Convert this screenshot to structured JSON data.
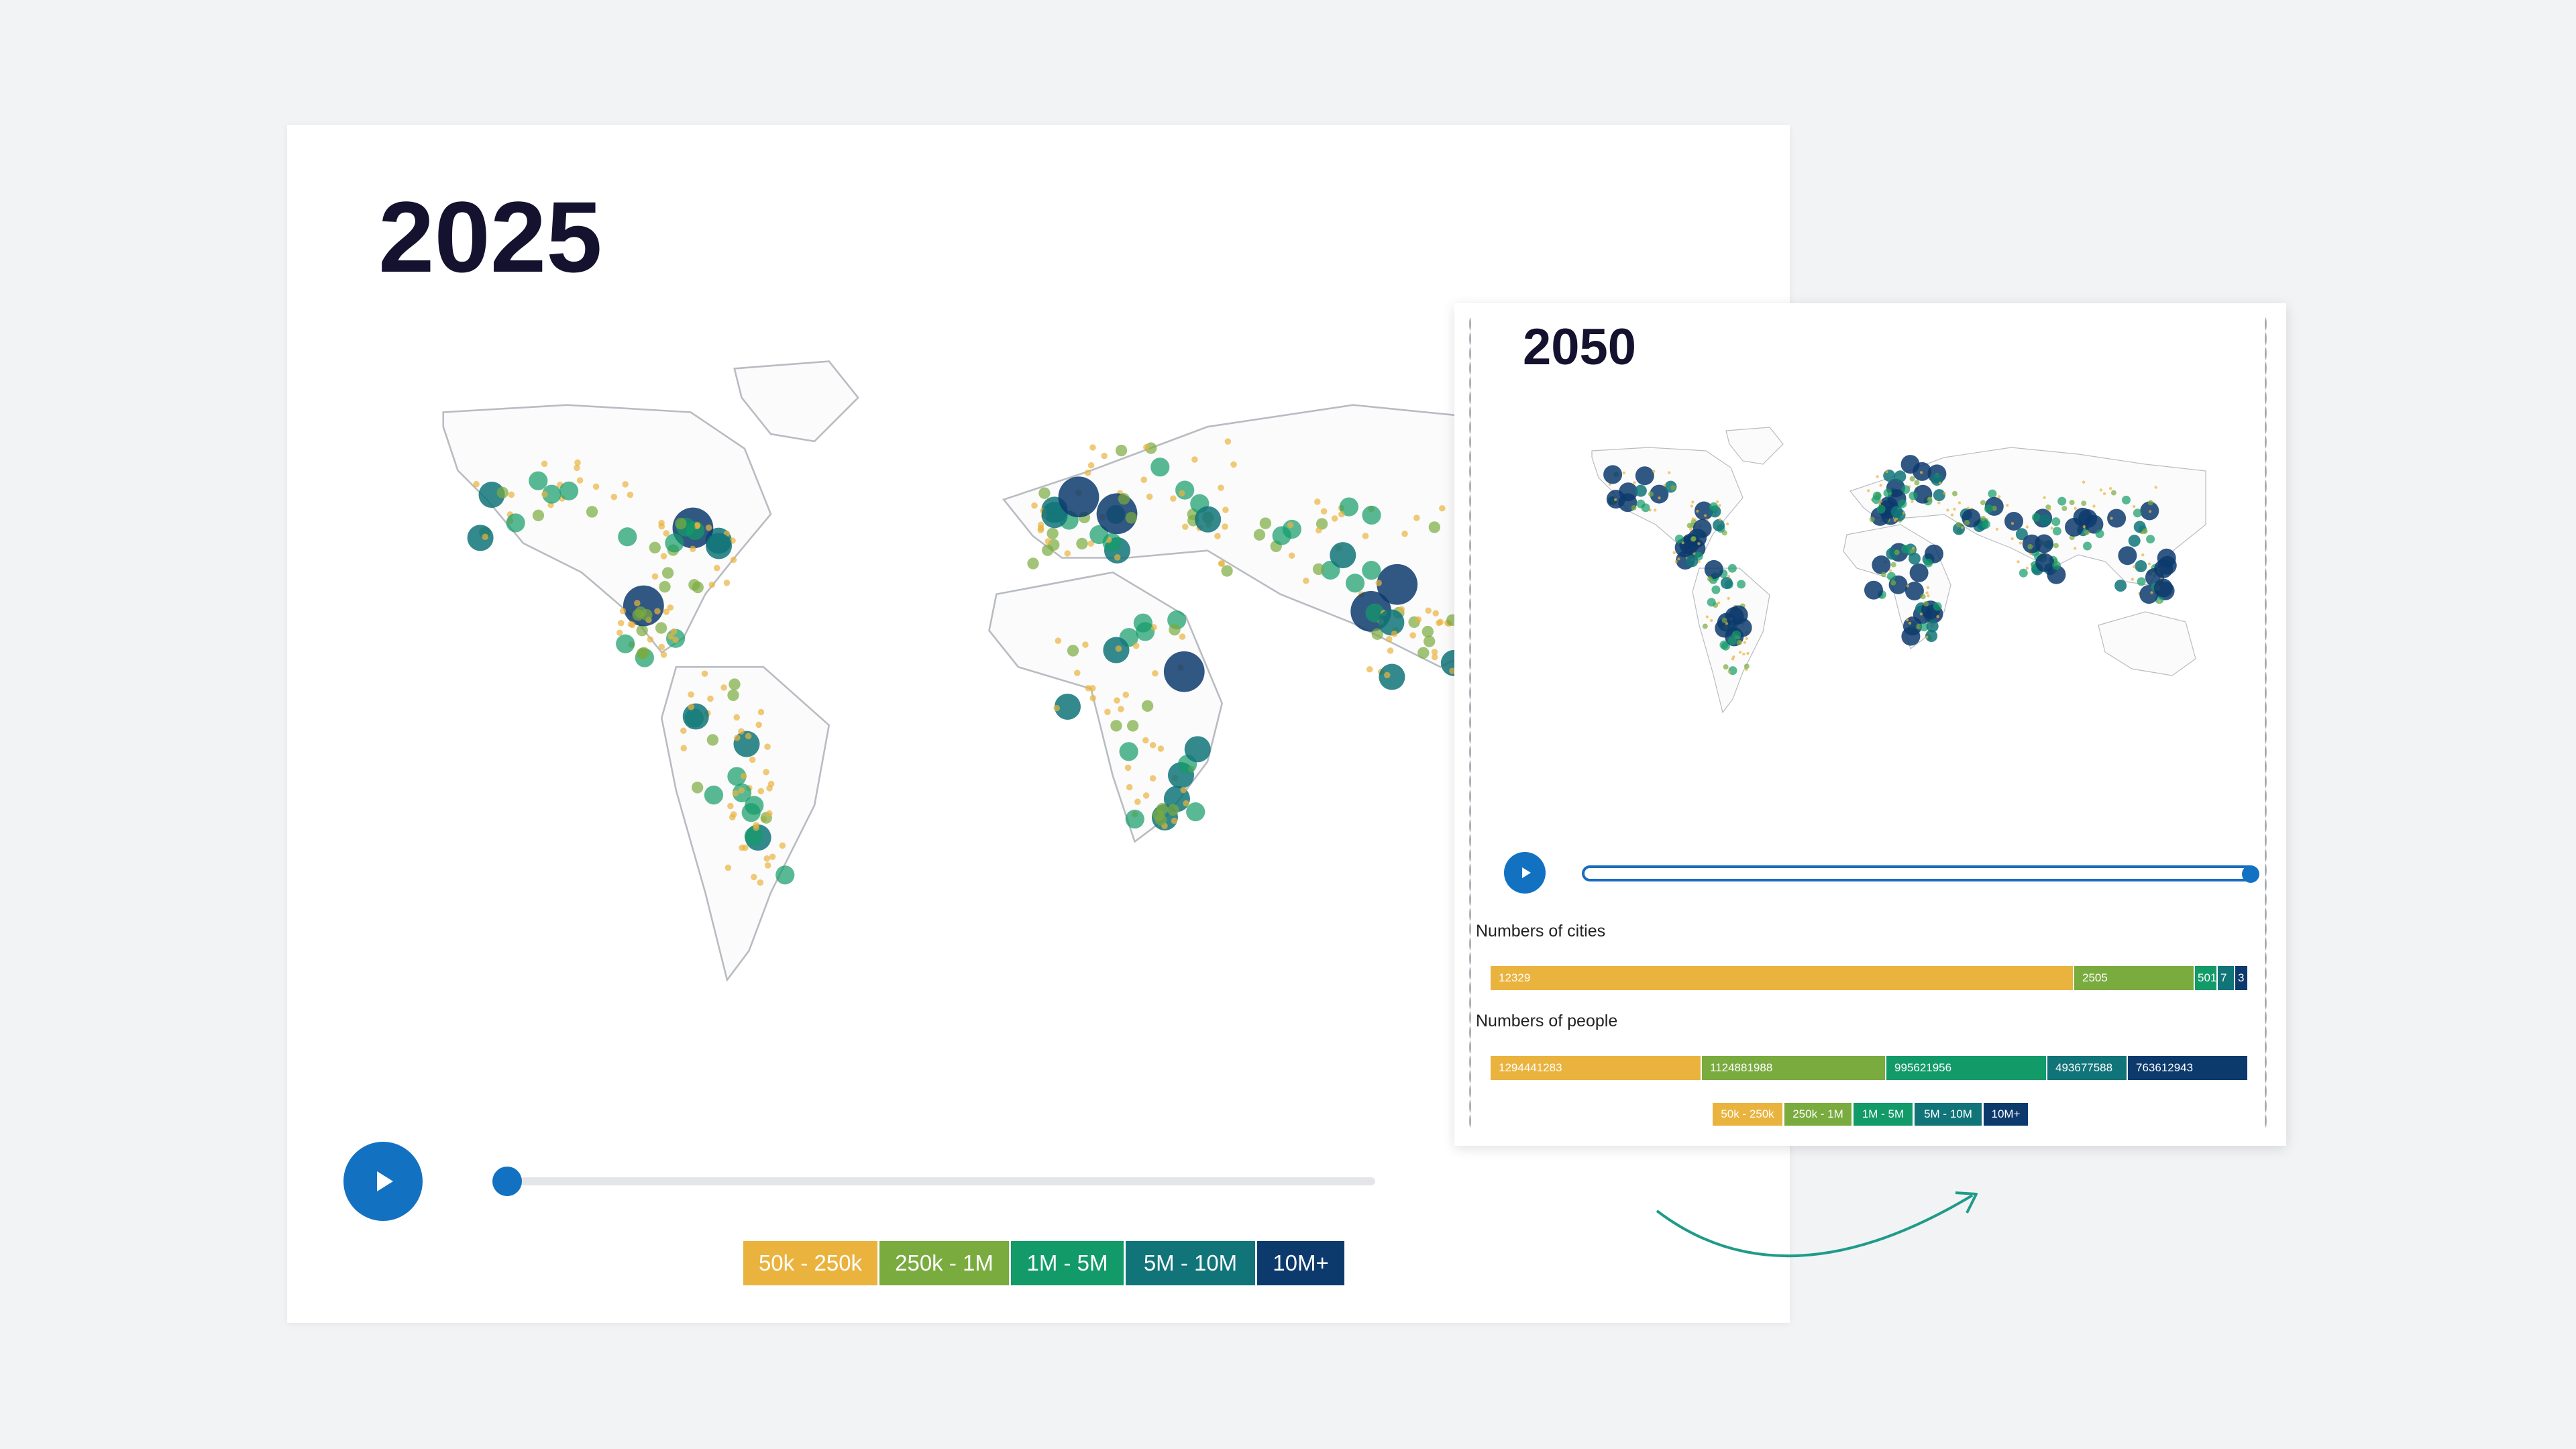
{
  "colors": {
    "bucket_50k_250k": "#e9b33e",
    "bucket_250k_1m": "#7aab3f",
    "bucket_1m_5m": "#129b68",
    "bucket_5m_10m": "#107479",
    "bucket_10m_plus": "#0d3a6d",
    "accent": "#1371c2",
    "arrow": "#1f9b8a"
  },
  "legend": [
    "50k - 250k",
    "250k - 1M",
    "1M - 5M",
    "5M - 10M",
    "10M+"
  ],
  "view_2025": {
    "year": "2025",
    "timeline_progress": 0
  },
  "view_2050": {
    "year": "2050",
    "timeline_progress": 1,
    "cities_title": "Numbers of cities",
    "people_title": "Numbers of people",
    "cities": [
      "12329",
      "2505",
      "501",
      "7",
      "3"
    ],
    "people": [
      "1294441283",
      "1124881988",
      "995621956",
      "493677588",
      "763612943"
    ]
  },
  "icons": {
    "play": "play-icon",
    "arrow": "curved-arrow-icon"
  }
}
